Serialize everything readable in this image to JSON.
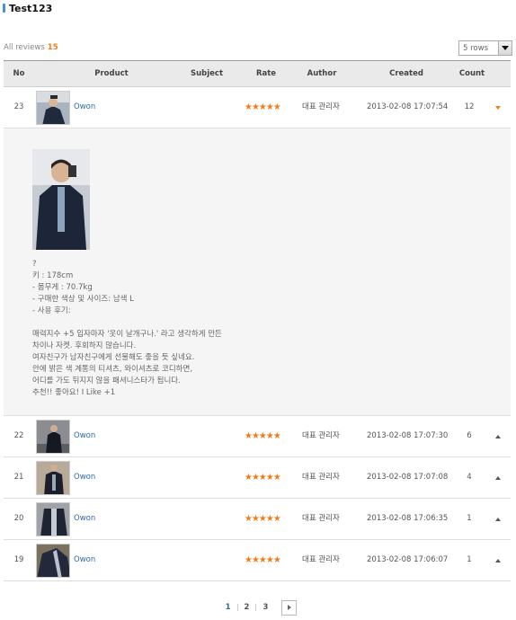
{
  "page": {
    "title": "Test123",
    "summary_label": "All reviews",
    "summary_count": "15",
    "rows_select": {
      "selected": "5 rows"
    }
  },
  "table": {
    "headers": [
      "No",
      "Product",
      "Subject",
      "Rate",
      "Author",
      "Created",
      "Count"
    ],
    "rows": [
      {
        "no": "23",
        "product": "Owon",
        "rating": 5,
        "stars": "★★★★★",
        "author": "대표 관리자",
        "created": "2013-02-08 17:07:54",
        "count": "12",
        "expanded": true
      },
      {
        "no": "22",
        "product": "Owon",
        "rating": 5,
        "stars": "★★★★★",
        "author": "대표 관리자",
        "created": "2013-02-08 17:07:30",
        "count": "6",
        "expanded": false
      },
      {
        "no": "21",
        "product": "Owon",
        "rating": 5,
        "stars": "★★★★★",
        "author": "대표 관리자",
        "created": "2013-02-08 17:07:08",
        "count": "4",
        "expanded": false
      },
      {
        "no": "20",
        "product": "Owon",
        "rating": 5,
        "stars": "★★★★★",
        "author": "대표 관리자",
        "created": "2013-02-08 17:06:35",
        "count": "1",
        "expanded": false
      },
      {
        "no": "19",
        "product": "Owon",
        "rating": 5,
        "stars": "★★★★★",
        "author": "대표 관리자",
        "created": "2013-02-08 17:06:07",
        "count": "1",
        "expanded": false
      }
    ]
  },
  "detail": {
    "lines": [
      "?",
      " 키 : 178cm",
      "- 몸무게 : 70.7kg",
      "- 구매한 색상 및 사이즈: 남색 L",
      "- 사용 후기:",
      "",
      "매력지수 +5 입자마자 '옷이 날개구나.' 라고 생각하게 만든",
      "차이나 자켓. 후회하지 않습니다.",
      "여자친구가 남자친구에게 선물해도 좋을 듯 싶네요.",
      "안에 밝은 색 계통의 티셔츠, 와이셔츠로 코디하면,",
      "어디를 가도 뒤지지 않을 패셔니스타가 됩니다.",
      "추천!! 좋아요! I Like +1"
    ]
  },
  "pagination": {
    "pages": [
      "1",
      "2",
      "3"
    ],
    "current": "1"
  },
  "colors": {
    "accent": "#f07d1a",
    "link": "#2d6aa8",
    "title_mark": "#4a8fd6"
  }
}
